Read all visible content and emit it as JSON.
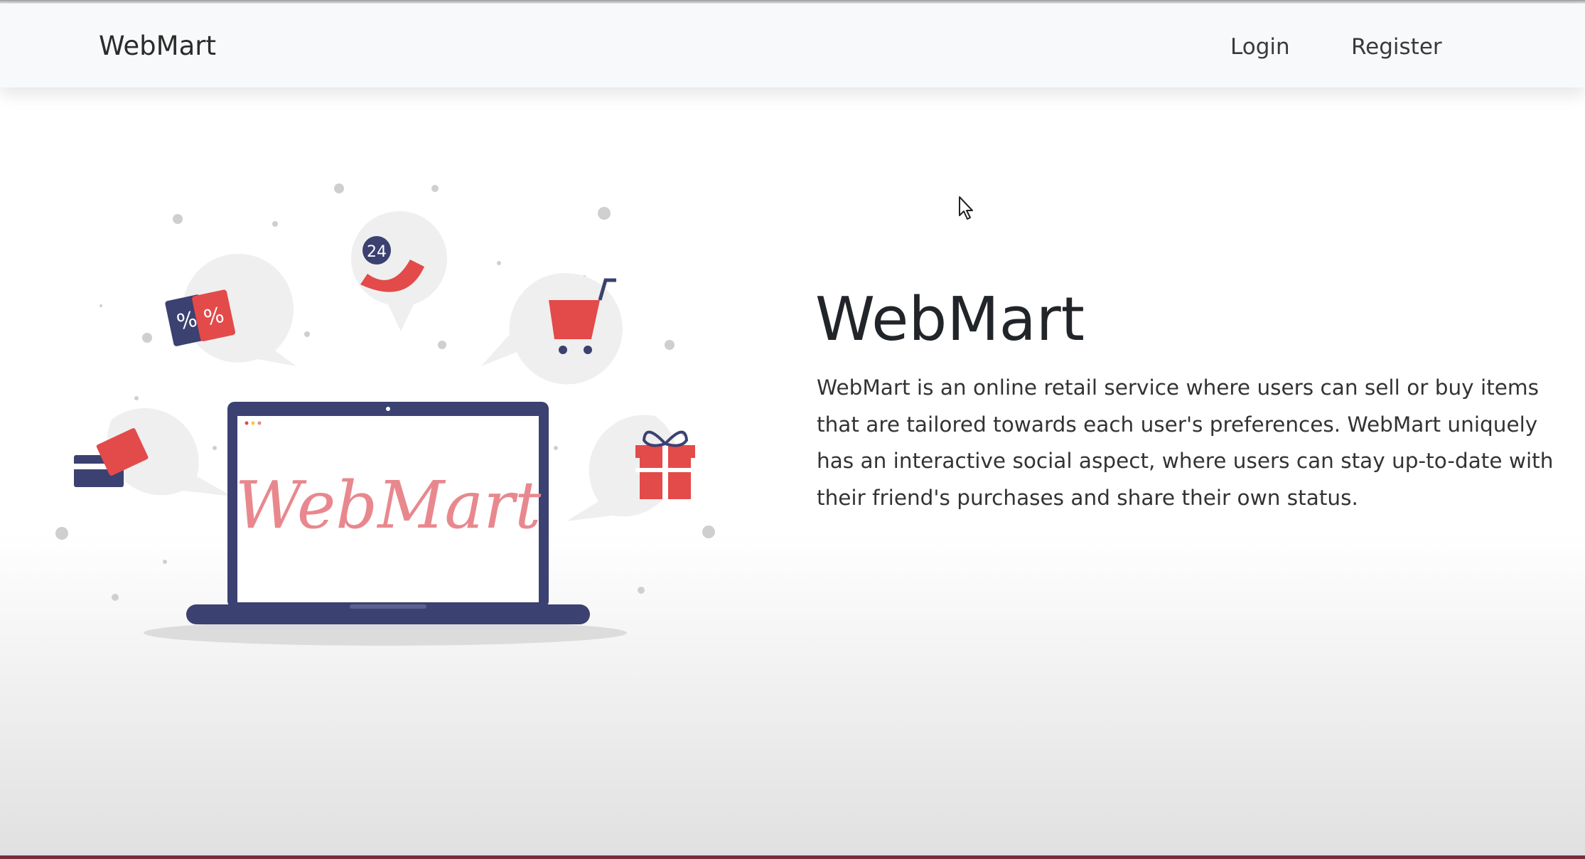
{
  "navbar": {
    "brand": "WebMart",
    "links": {
      "login": "Login",
      "register": "Register"
    }
  },
  "hero": {
    "title": "WebMart",
    "description": "WebMart is an online retail service where users can sell or buy items that are tailored towards each user's preferences. WebMart uniquely has an interactive social aspect, where users can stay up-to-date with their friend's purchases and share their own status.",
    "illustration": {
      "screen_text": "WebMart",
      "phone_badge": "24",
      "tag_symbol": "%",
      "icons": [
        "price-tag-icon",
        "phone-24h-icon",
        "shopping-cart-icon",
        "credit-card-icon",
        "gift-icon",
        "laptop-icon"
      ]
    }
  },
  "colors": {
    "navy": "#3b4170",
    "red": "#e34a4a",
    "pink_script": "#e8888e",
    "bubble": "#efefef",
    "navbar_bg": "#f8f9fa"
  }
}
